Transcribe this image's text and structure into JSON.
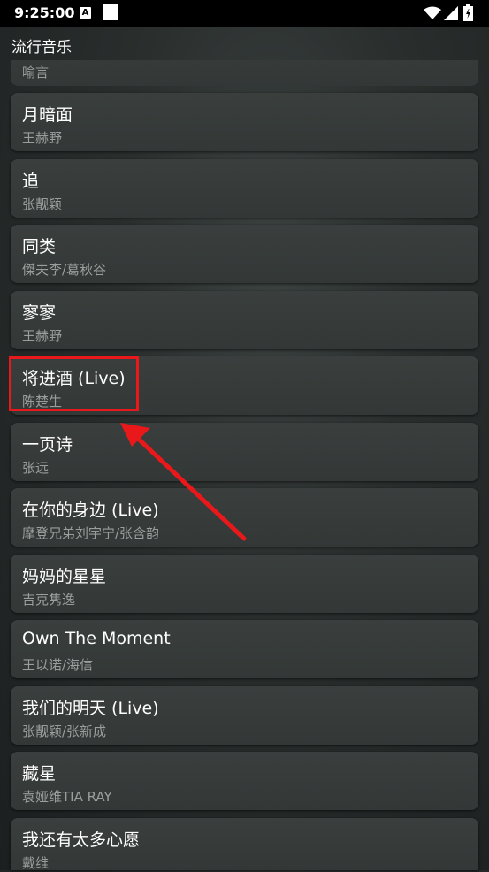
{
  "status_bar": {
    "time": "9:25:00",
    "notification_icon_letter": "A",
    "icons": [
      "a-notification-icon",
      "square-notification-icon",
      "wifi-icon",
      "signal-icon",
      "battery-icon"
    ]
  },
  "app": {
    "title": "流行音乐"
  },
  "songs": [
    {
      "title": "",
      "artist": "喻言"
    },
    {
      "title": "月暗面",
      "artist": "王赫野"
    },
    {
      "title": "追",
      "artist": "张靓颖"
    },
    {
      "title": "同类",
      "artist": "傑夫李/葛秋谷"
    },
    {
      "title": "寥寥",
      "artist": "王赫野"
    },
    {
      "title": "将进酒 (Live)",
      "artist": "陈楚生"
    },
    {
      "title": "一页诗",
      "artist": "张远"
    },
    {
      "title": "在你的身边 (Live)",
      "artist": "摩登兄弟刘宇宁/张含韵"
    },
    {
      "title": "妈妈的星星",
      "artist": "吉克隽逸"
    },
    {
      "title": "Own The Moment",
      "artist": "王以诺/海信"
    },
    {
      "title": "我们的明天 (Live)",
      "artist": "张靓颖/张新成"
    },
    {
      "title": "藏星",
      "artist": "袁娅维TIA RAY"
    },
    {
      "title": "我还有太多心愿",
      "artist": "戴维"
    }
  ],
  "annotation": {
    "highlight_color": "#e8181b",
    "highlighted_song": "将进酒 (Live)"
  }
}
